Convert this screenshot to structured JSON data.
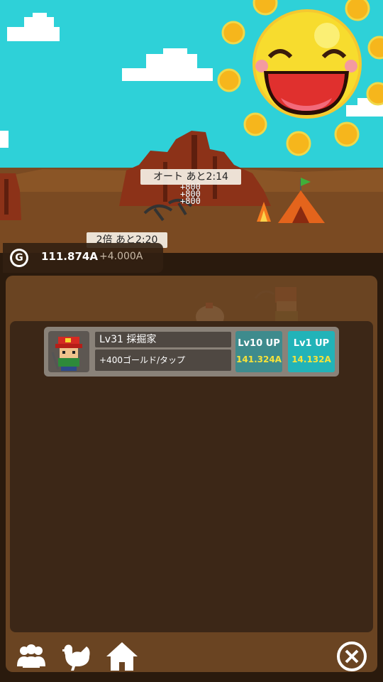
{
  "timers": {
    "auto": "オート あと2:14",
    "double": "2倍 あと2:20"
  },
  "floating_numbers": [
    "+800",
    "+800",
    "+800"
  ],
  "gold": {
    "icon": "gold-coin-icon",
    "icon_letter": "G",
    "amount": "111.874A",
    "rate": "+4.000A"
  },
  "unit": {
    "name": "Lv31 採掘家",
    "description": "+400ゴールド/タップ",
    "up10": {
      "label": "Lv10 UP",
      "cost": "141.324A"
    },
    "up1": {
      "label": "Lv1 UP",
      "cost": "14.132A"
    }
  },
  "nav": {
    "icons": [
      "team-icon",
      "chicken-icon",
      "home-icon",
      "close-icon"
    ]
  },
  "colors": {
    "sky": "#2ed1d8",
    "ground": "#7a4a22",
    "sun": "#f7dc2e",
    "accent_teal": "#22b3b8",
    "cost_yellow": "#f6e23a"
  }
}
